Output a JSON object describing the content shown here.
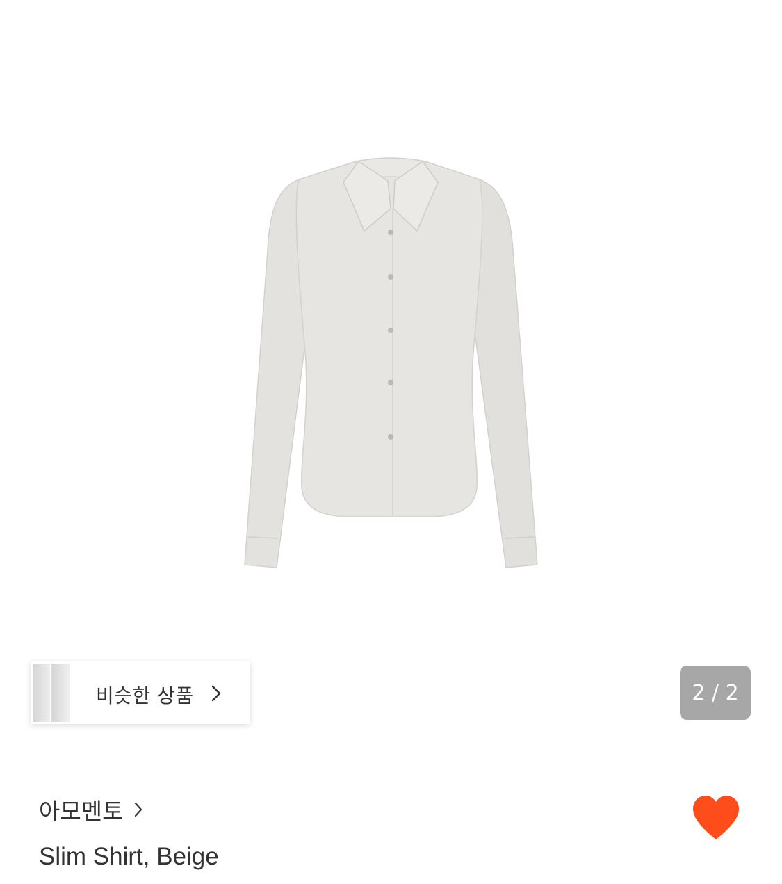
{
  "product": {
    "image_alt": "Slim Shirt, Beige",
    "brand": "아모멘토",
    "name": "Slim Shirt, Beige"
  },
  "gallery": {
    "page_indicator": "2 / 2"
  },
  "similar_products": {
    "label": "비슷한 상품"
  },
  "icons": {
    "brand_chevron": "chevron-right-icon",
    "similar_chevron": "chevron-right-icon",
    "like": "heart-icon"
  },
  "colors": {
    "like_heart": "#ff4c1b",
    "indicator_bg": "#a7a7a7",
    "shirt": "#e4e3e0"
  }
}
